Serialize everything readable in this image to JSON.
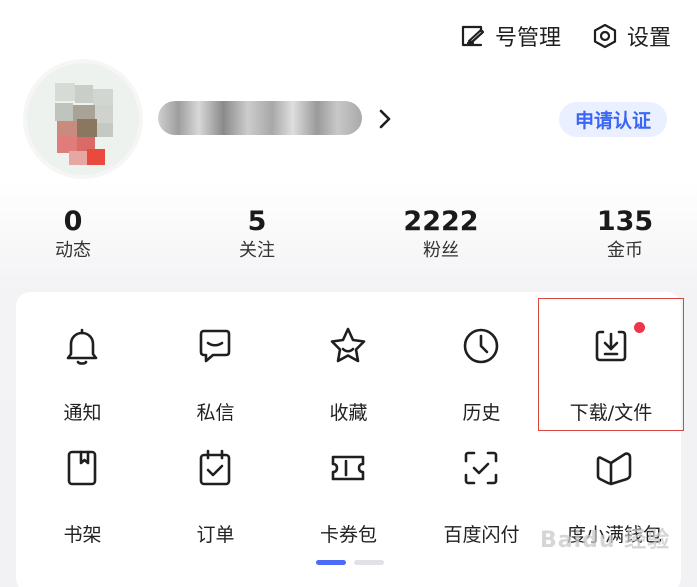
{
  "header": {
    "account_manage_label": "号管理",
    "settings_label": "设置"
  },
  "profile": {
    "verify_label": "申请认证"
  },
  "stats": [
    {
      "value": "0",
      "label": "动态"
    },
    {
      "value": "5",
      "label": "关注"
    },
    {
      "value": "2222",
      "label": "粉丝"
    },
    {
      "value": "135",
      "label": "金币"
    }
  ],
  "grid": {
    "row1": [
      {
        "label": "通知",
        "icon": "bell-icon"
      },
      {
        "label": "私信",
        "icon": "message-icon"
      },
      {
        "label": "收藏",
        "icon": "star-icon"
      },
      {
        "label": "历史",
        "icon": "clock-icon"
      },
      {
        "label": "下载/文件",
        "icon": "download-icon"
      }
    ],
    "row2": [
      {
        "label": "书架",
        "icon": "bookshelf-icon"
      },
      {
        "label": "订单",
        "icon": "calendar-check-icon"
      },
      {
        "label": "卡券包",
        "icon": "ticket-icon"
      },
      {
        "label": "百度闪付",
        "icon": "scan-check-icon"
      },
      {
        "label": "度小满钱包",
        "icon": "wallet-icon"
      }
    ]
  },
  "colors": {
    "accent": "#3a66f5",
    "badge": "#f0344b",
    "highlight": "#d9463e"
  },
  "watermark": "Baidu 经验"
}
